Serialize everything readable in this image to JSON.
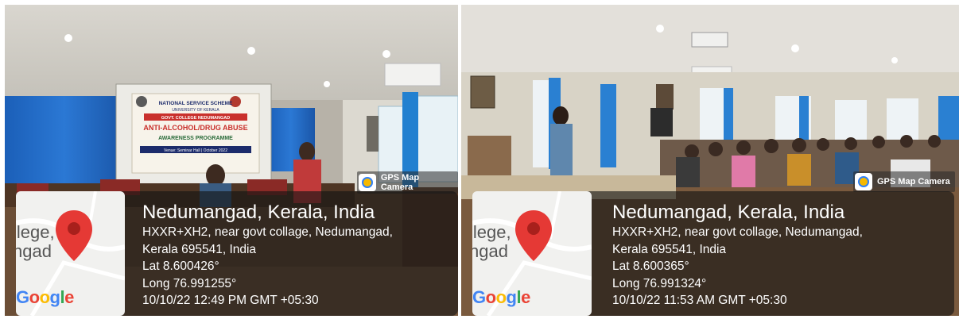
{
  "photos": [
    {
      "app_label": "GPS Map Camera",
      "map_label": "llege,\nngad",
      "google_letters": [
        "G",
        "o",
        "o",
        "g",
        "l",
        "e"
      ],
      "location_title": "Nedumangad, Kerala, India",
      "address_line1": "HXXR+XH2, near govt collage, Nedumangad,",
      "address_line2": "Kerala 695541, India",
      "lat": "Lat 8.600426°",
      "long": "Long 76.991255°",
      "timestamp": "10/10/22 12:49 PM GMT +05:30",
      "banner": {
        "line1": "NATIONAL SERVICE SCHEME",
        "line2": "UNIVERSITY OF KERALA",
        "line3": "GOVT. COLLEGE NEDUMANGAD",
        "line4": "ANTI-ALCOHOL/DRUG ABUSE",
        "line5": "AWARENESS PROGRAMME",
        "line6": "Venue: Seminar Hall | October 2022"
      }
    },
    {
      "app_label": "GPS Map Camera",
      "map_label": "llege,\nngad",
      "google_letters": [
        "G",
        "o",
        "o",
        "g",
        "l",
        "e"
      ],
      "location_title": "Nedumangad, Kerala, India",
      "address_line1": "HXXR+XH2, near govt collage, Nedumangad,",
      "address_line2": "Kerala 695541, India",
      "lat": "Lat 8.600365°",
      "long": "Long 76.991324°",
      "timestamp": "10/10/22 11:53 AM GMT +05:30"
    }
  ],
  "colors": {
    "google_blue": "#4285F4",
    "google_red": "#EA4335",
    "google_yellow": "#FBBC05",
    "google_green": "#34A853",
    "pin_red": "#e53935"
  }
}
